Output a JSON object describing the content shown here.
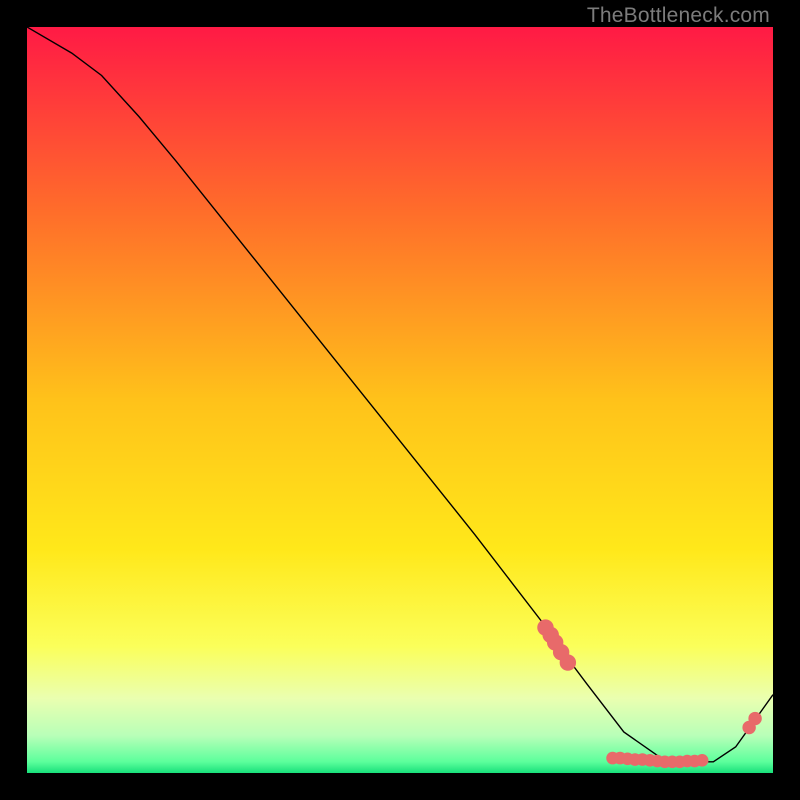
{
  "watermark": "TheBottleneck.com",
  "colors": {
    "background": "#000000",
    "marker": "#e86a6a",
    "line": "#000000"
  },
  "chart_data": {
    "type": "line",
    "title": "",
    "xlabel": "",
    "ylabel": "",
    "xlim": [
      0,
      100
    ],
    "ylim": [
      0,
      100
    ],
    "grid": false,
    "legend": false,
    "gradient_stops": [
      {
        "offset": 0.0,
        "color": "#ff1a45"
      },
      {
        "offset": 0.25,
        "color": "#ff6e2a"
      },
      {
        "offset": 0.5,
        "color": "#ffc21a"
      },
      {
        "offset": 0.7,
        "color": "#ffe81a"
      },
      {
        "offset": 0.83,
        "color": "#fbff5a"
      },
      {
        "offset": 0.9,
        "color": "#eaffb0"
      },
      {
        "offset": 0.95,
        "color": "#b8ffb8"
      },
      {
        "offset": 0.985,
        "color": "#5cff9c"
      },
      {
        "offset": 1.0,
        "color": "#18e07a"
      }
    ],
    "series": [
      {
        "name": "bottleneck-curve",
        "x": [
          0,
          6,
          10,
          15,
          20,
          30,
          40,
          50,
          60,
          65,
          70,
          72,
          75,
          80,
          85,
          90,
          92,
          95,
          100
        ],
        "y": [
          100,
          96.5,
          93.5,
          88,
          82,
          69.5,
          57,
          44.5,
          32,
          25.5,
          19,
          16,
          12,
          5.5,
          2,
          1.5,
          1.5,
          3.5,
          10.5
        ]
      }
    ],
    "markers": [
      {
        "name": "cluster-a",
        "x": 69.5,
        "y": 19.5,
        "r": 1.1
      },
      {
        "name": "cluster-a",
        "x": 70.2,
        "y": 18.5,
        "r": 1.1
      },
      {
        "name": "cluster-a",
        "x": 70.8,
        "y": 17.5,
        "r": 1.1
      },
      {
        "name": "cluster-a",
        "x": 71.6,
        "y": 16.2,
        "r": 1.1
      },
      {
        "name": "cluster-a",
        "x": 72.5,
        "y": 14.8,
        "r": 1.1
      },
      {
        "name": "cluster-b",
        "x": 78.5,
        "y": 2.0,
        "r": 0.85
      },
      {
        "name": "cluster-b",
        "x": 79.5,
        "y": 2.0,
        "r": 0.85
      },
      {
        "name": "cluster-b",
        "x": 80.5,
        "y": 1.9,
        "r": 0.85
      },
      {
        "name": "cluster-b",
        "x": 81.5,
        "y": 1.8,
        "r": 0.85
      },
      {
        "name": "cluster-b",
        "x": 82.5,
        "y": 1.8,
        "r": 0.85
      },
      {
        "name": "cluster-b",
        "x": 83.5,
        "y": 1.7,
        "r": 0.85
      },
      {
        "name": "cluster-b",
        "x": 84.5,
        "y": 1.6,
        "r": 0.85
      },
      {
        "name": "cluster-b",
        "x": 85.5,
        "y": 1.5,
        "r": 0.85
      },
      {
        "name": "cluster-b",
        "x": 86.5,
        "y": 1.5,
        "r": 0.85
      },
      {
        "name": "cluster-b",
        "x": 87.5,
        "y": 1.5,
        "r": 0.85
      },
      {
        "name": "cluster-b",
        "x": 88.5,
        "y": 1.6,
        "r": 0.85
      },
      {
        "name": "cluster-b",
        "x": 89.5,
        "y": 1.6,
        "r": 0.85
      },
      {
        "name": "cluster-b",
        "x": 90.5,
        "y": 1.7,
        "r": 0.85
      },
      {
        "name": "cluster-c",
        "x": 96.8,
        "y": 6.1,
        "r": 0.9
      },
      {
        "name": "cluster-c",
        "x": 97.6,
        "y": 7.3,
        "r": 0.9
      }
    ]
  }
}
